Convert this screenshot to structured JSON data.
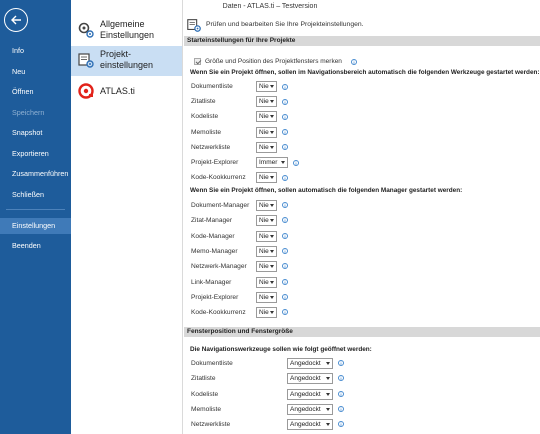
{
  "titlebar": {
    "text": "Daten - ATLAS.ti – Testversion"
  },
  "nav": {
    "items": [
      {
        "label": "Info",
        "state": "normal"
      },
      {
        "label": "Neu",
        "state": "normal"
      },
      {
        "label": "Öffnen",
        "state": "normal"
      },
      {
        "label": "Speichern",
        "state": "disabled"
      },
      {
        "label": "Snapshot",
        "state": "normal"
      },
      {
        "label": "Exportieren",
        "state": "normal"
      },
      {
        "label": "Zusammenführen",
        "state": "normal"
      },
      {
        "label": "Schließen",
        "state": "normal"
      },
      {
        "label": "Einstellungen",
        "state": "active"
      },
      {
        "label": "Beenden",
        "state": "normal"
      }
    ]
  },
  "categories": [
    {
      "label_line1": "Allgemeine",
      "label_line2": "Einstellungen",
      "icon": "gear-icon"
    },
    {
      "label_line1": "Projekt-",
      "label_line2": "einstellungen",
      "icon": "project-settings-icon"
    },
    {
      "label_line1": "ATLAS.ti",
      "label_line2": "",
      "icon": "atlasti-logo-icon"
    }
  ],
  "header": {
    "text": "Prüfen und bearbeiten Sie Ihre Projekteinstellungen."
  },
  "sections": {
    "start": {
      "title": "Starteinstellungen für Ihre Projekte",
      "checkbox_label": "Größe und Position des Projektfensters merken",
      "tools_heading": "Wenn Sie ein Projekt öffnen, sollen im Navigationsbereich automatisch die folgenden Werkzeuge gestartet werden:",
      "tools": [
        {
          "label": "Dokumentliste",
          "value": "Nie"
        },
        {
          "label": "Zitatliste",
          "value": "Nie"
        },
        {
          "label": "Kodeliste",
          "value": "Nie"
        },
        {
          "label": "Memoliste",
          "value": "Nie"
        },
        {
          "label": "Netzwerkliste",
          "value": "Nie"
        },
        {
          "label": "Projekt-Explorer",
          "value": "Immer"
        },
        {
          "label": "Kode-Kookkurrenz",
          "value": "Nie"
        }
      ],
      "managers_heading": "Wenn Sie ein Projekt öffnen, sollen automatisch die folgenden Manager gestartet werden:",
      "managers": [
        {
          "label": "Dokument-Manager",
          "value": "Nie"
        },
        {
          "label": "Zitat-Manager",
          "value": "Nie"
        },
        {
          "label": "Kode-Manager",
          "value": "Nie"
        },
        {
          "label": "Memo-Manager",
          "value": "Nie"
        },
        {
          "label": "Netzwerk-Manager",
          "value": "Nie"
        },
        {
          "label": "Link-Manager",
          "value": "Nie"
        },
        {
          "label": "Projekt-Explorer",
          "value": "Nie"
        },
        {
          "label": "Kode-Kookkurrenz",
          "value": "Nie"
        }
      ]
    },
    "window": {
      "title": "Fensterposition und Fenstergröße",
      "heading": "Die Navigationswerkzeuge sollen wie folgt geöffnet werden:",
      "tools": [
        {
          "label": "Dokumentliste",
          "value": "Angedockt"
        },
        {
          "label": "Zitatliste",
          "value": "Angedockt"
        },
        {
          "label": "Kodeliste",
          "value": "Angedockt"
        },
        {
          "label": "Memoliste",
          "value": "Angedockt"
        },
        {
          "label": "Netzwerkliste",
          "value": "Angedockt"
        }
      ]
    }
  },
  "info_glyph": "i",
  "colors": {
    "nav_bg": "#1e5c9b",
    "nav_active": "#3f7ab8",
    "cat_active": "#c9def3",
    "section_bar": "#d8d8d8",
    "logo_red": "#e2231a"
  }
}
